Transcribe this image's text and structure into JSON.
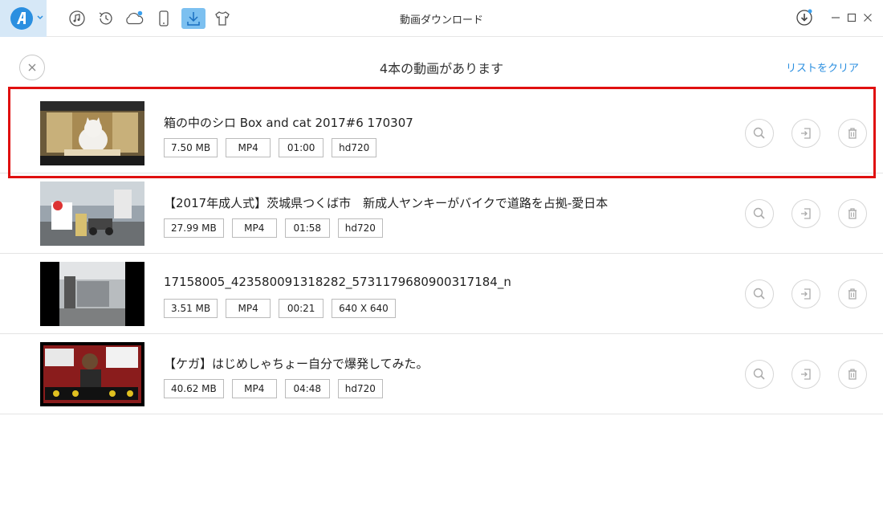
{
  "window": {
    "title": "動画ダウンロード"
  },
  "toolbar": {
    "icons": [
      "app-logo-icon",
      "music-icon",
      "history-icon",
      "cloud-icon",
      "phone-icon",
      "download-icon",
      "tshirt-icon"
    ],
    "active": "download-icon",
    "accent": "#2b8fe0",
    "badge_color": "#3aa0ee"
  },
  "header": {
    "title": "4本の動画があります",
    "clear_label": "リストをクリア"
  },
  "videos": [
    {
      "title": "箱の中のシロ Box and cat 2017#6 170307",
      "size": "7.50 MB",
      "format": "MP4",
      "duration": "01:00",
      "quality": "hd720"
    },
    {
      "title": "【2017年成人式】茨城県つくば市　新成人ヤンキーがバイクで道路を占拠-愛日本",
      "size": "27.99 MB",
      "format": "MP4",
      "duration": "01:58",
      "quality": "hd720"
    },
    {
      "title": "17158005_423580091318282_5731179680900317184_n",
      "size": "3.51 MB",
      "format": "MP4",
      "duration": "00:21",
      "quality": "640 X 640"
    },
    {
      "title": "【ケガ】はじめしゃちょー自分で爆発してみた。",
      "size": "40.62 MB",
      "format": "MP4",
      "duration": "04:48",
      "quality": "hd720"
    }
  ],
  "row_actions": [
    "search-icon",
    "export-icon",
    "trash-icon"
  ],
  "highlight_color": "#e01010"
}
